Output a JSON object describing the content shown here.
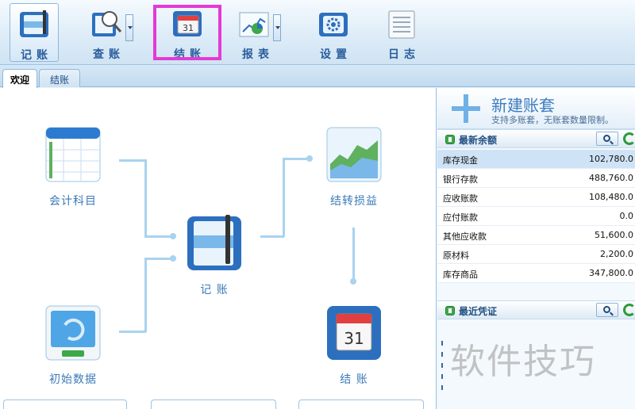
{
  "toolbar": {
    "items": [
      {
        "label": "记账",
        "icon": "ledger-book-icon"
      },
      {
        "label": "查账",
        "icon": "magnifier-book-icon"
      },
      {
        "label": "结账",
        "icon": "calendar-31-icon"
      },
      {
        "label": "报表",
        "icon": "chart-report-icon"
      },
      {
        "label": "设置",
        "icon": "gear-settings-icon"
      },
      {
        "label": "日志",
        "icon": "log-list-icon"
      }
    ],
    "calendar_day": "31"
  },
  "tabs": [
    {
      "label": "欢迎",
      "active": true
    },
    {
      "label": "结账",
      "active": false
    }
  ],
  "flow": {
    "subjects": "会计科目",
    "transfer": "结转损益",
    "record": "记 账",
    "initial": "初始数据",
    "close": "结 账",
    "calendar_day": "31"
  },
  "side": {
    "new_set_title": "新建账套",
    "new_set_desc": "支持多账套，无账套数量限制。",
    "balance_title": "最新余额",
    "balances": [
      {
        "name": "库存现金",
        "value": "102,780.0"
      },
      {
        "name": "银行存款",
        "value": "488,760.0"
      },
      {
        "name": "应收账款",
        "value": "108,480.0"
      },
      {
        "name": "应付账款",
        "value": "0.0"
      },
      {
        "name": "其他应收款",
        "value": "51,600.0"
      },
      {
        "name": "原材料",
        "value": "2,200.0"
      },
      {
        "name": "库存商品",
        "value": "347,800.0"
      }
    ],
    "voucher_title": "最近凭证"
  },
  "watermark": "软件技巧",
  "colors": {
    "accent": "#3b7cc0",
    "highlight": "#e33ad6",
    "connector": "#a9d3ef"
  }
}
